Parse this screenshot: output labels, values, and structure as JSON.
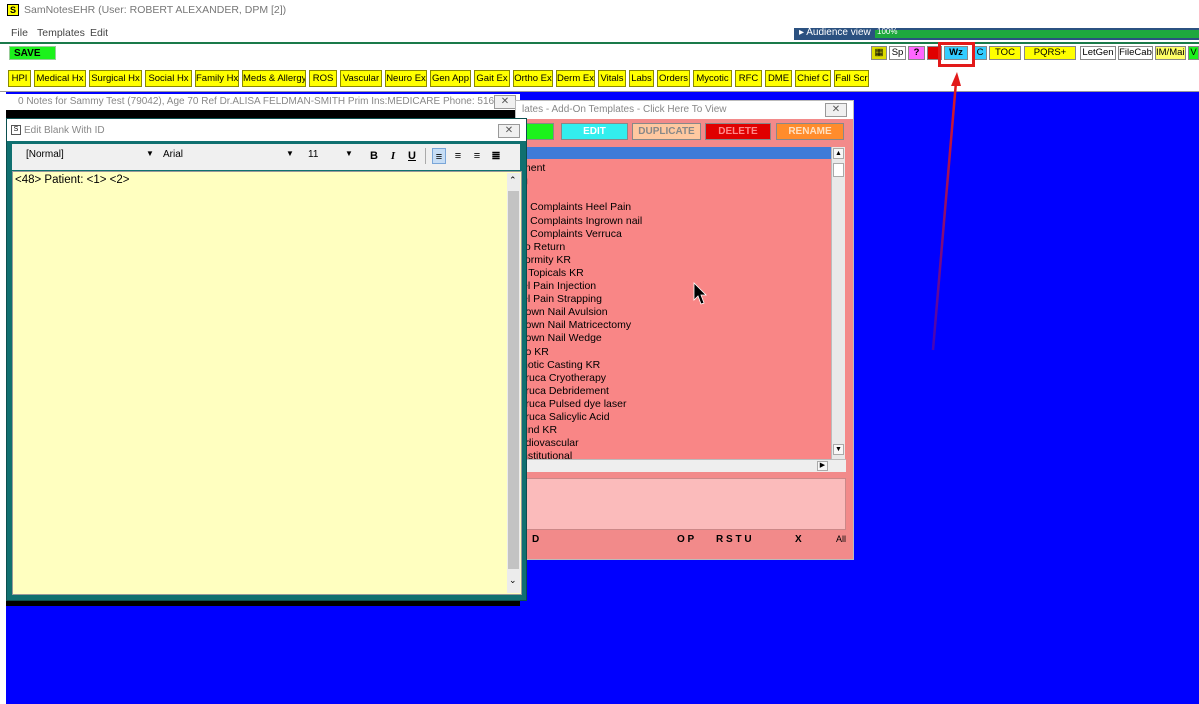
{
  "app": {
    "title": "SamNotesEHR (User: ROBERT ALEXANDER, DPM [2])",
    "icon_letter": "S"
  },
  "menu": [
    "File",
    "Templates",
    "Edit"
  ],
  "audience": {
    "label": "▸  Audience view",
    "percent": "100%"
  },
  "toolbar": {
    "save_label": "SAVE",
    "buttons": [
      {
        "label": "▦"
      },
      {
        "label": "Sp"
      },
      {
        "label": "?"
      },
      {
        "label": "C"
      },
      {
        "label": "Wz"
      },
      {
        "label": "C"
      },
      {
        "label": "TOC"
      },
      {
        "label": "PQRS+"
      },
      {
        "label": "LetGen"
      },
      {
        "label": "FileCab"
      },
      {
        "label": "IM/Mail"
      },
      {
        "label": "V"
      }
    ]
  },
  "template_buttons": [
    "HPI",
    "Medical Hx",
    "Surgical Hx",
    "Social Hx",
    "Family Hx",
    "Meds & Allergy",
    "ROS",
    "Vascular",
    "Neuro Ex",
    "Gen App",
    "Gait Ex",
    "Ortho Ex",
    "Derm Ex",
    "Vitals",
    "Labs",
    "Orders",
    "Mycotic",
    "RFC",
    "DME",
    "Chief C",
    "Fall Scr"
  ],
  "notes_window": {
    "title": "0 Notes for Sammy Test (79042), Age 70  Ref Dr.ALISA FELDMAN-SMITH  Prim Ins:MEDICARE Phone: 516-..."
  },
  "addon_window": {
    "title": "lates - Add-On Templates - Click Here To View",
    "buttons": {
      "new": "N",
      "edit": "EDIT",
      "duplicate": "DUPLICATE",
      "delete": "DELETE",
      "rename": "RENAME"
    },
    "items": [
      "",
      "ment",
      "g",
      "",
      "ti Complaints Heel Pain",
      "ti Complaints Ingrown nail",
      "ti Complaints Verruca",
      "to Return",
      "formity KR",
      "r Topicals KR",
      "el Pain Injection",
      "el Pain Strapping",
      "rown Nail Avulsion",
      "rown Nail Matricectomy",
      "rown Nail Wedge",
      "ro KR",
      "hotic Casting KR",
      "rruca Cryotherapy",
      "rruca Debridement",
      "rruca Pulsed dye laser",
      "rruca Salicylic Acid",
      "und KR",
      "rdiovascular",
      "nstitutional"
    ],
    "alpha": {
      "d": "D",
      "op": "O P",
      "rstu": "R S T U",
      "x": "X",
      "all": "All"
    }
  },
  "edit_window": {
    "title": "Edit Blank With ID",
    "style_select": "[Normal]",
    "font_select": "Arial",
    "size_select": "11",
    "format_buttons": {
      "bold": "B",
      "italic": "I",
      "underline": "U"
    },
    "content": "<48> Patient: <1> <2>"
  },
  "colors": {
    "workspace": "#0000ff",
    "template_button": "#ffff00",
    "save": "#1cf21c",
    "addon_bg": "#f28a8a",
    "edit_area": "#ffffc0",
    "highlight": "#e21a1a"
  }
}
